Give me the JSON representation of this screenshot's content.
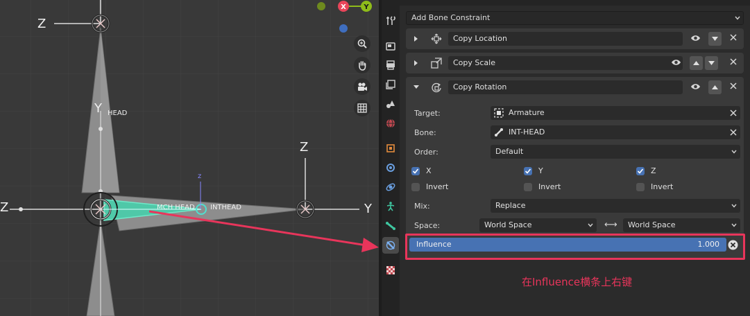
{
  "viewport": {
    "labels": {
      "z_top": "Z",
      "head_y": "Y",
      "head": "HEAD",
      "z_mid": "Z",
      "y_right": "Y",
      "z_left": "Z",
      "z_small": "z",
      "mch_head": "MCH HEAD",
      "int_head": "INTHEAD"
    },
    "gizmo": {
      "x": "X",
      "y": "Y"
    },
    "nav_icons": [
      "zoom-icon",
      "hand-pan-icon",
      "camera-icon",
      "grid-icon"
    ],
    "colors": {
      "bone": "#8f8f8f",
      "bone_selected": "#4fc8a8",
      "axis_red": "#e8455a",
      "axis_green": "#8fbc1a",
      "axis_blue": "#3f6ebf"
    }
  },
  "sidebar_tabs": [
    "tool-tab",
    "render-tab",
    "output-tab",
    "view-layer-tab",
    "scene-tab",
    "world-tab",
    "object-tab",
    "modifiers-tab",
    "physics-tab",
    "object-data-tab",
    "bone-tab",
    "bone-constraints-tab",
    "texture-tab"
  ],
  "properties": {
    "add_constraint": "Add Bone Constraint",
    "constraints": [
      {
        "name": "Copy Location"
      },
      {
        "name": "Copy Scale"
      },
      {
        "name": "Copy Rotation"
      }
    ],
    "copy_rotation": {
      "target_label": "Target:",
      "target_value": "Armature",
      "bone_label": "Bone:",
      "bone_value": "INT-HEAD",
      "order_label": "Order:",
      "order_value": "Default",
      "axis_x": "X",
      "axis_y": "Y",
      "axis_z": "Z",
      "invert": "Invert",
      "mix_label": "Mix:",
      "mix_value": "Replace",
      "space_label": "Space:",
      "owner_space": "World Space",
      "target_space": "World Space",
      "space_arrow": "⟷",
      "influence_label": "Influence",
      "influence_value": "1.000"
    }
  },
  "annotation": {
    "text": "在Influence横条上右键",
    "color": "#e8355b"
  }
}
